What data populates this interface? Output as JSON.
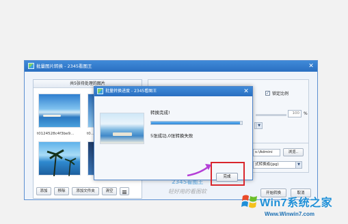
{
  "main_window": {
    "title": "批量图片转换 - 2345看图王",
    "close_glyph": "✕"
  },
  "left_panel": {
    "header": "共5张待处理的图片",
    "thumbnails": [
      {
        "caption": "t0124528c4f3be9..."
      },
      {
        "caption": "t0..."
      }
    ],
    "buttons": [
      "添加",
      "移除",
      "添加文件夹",
      "清空"
    ]
  },
  "settings": {
    "lock_ratio_label": "锁定比例",
    "percent_value": "100",
    "percent_unit": "%",
    "output_path": "s:\\Admini",
    "browse_label": "浏览..",
    "format_value": "式转换成(jpg)"
  },
  "progress_dialog": {
    "title": "批量转换进度 - 2345看图王",
    "close_glyph": "✕",
    "status": "转换完成!",
    "progress_fraction": 0.98,
    "summary": "5张成功,0张转换失败",
    "done_label": "完成"
  },
  "bottom_buttons": {
    "start_label": "开始转换",
    "cancel_label": "取消"
  },
  "watermark": {
    "small_logo": "2345看图王",
    "slogan": "轻好用的看图软",
    "brand": "Win7系统之家",
    "url": "Www.Winwin7.com"
  }
}
